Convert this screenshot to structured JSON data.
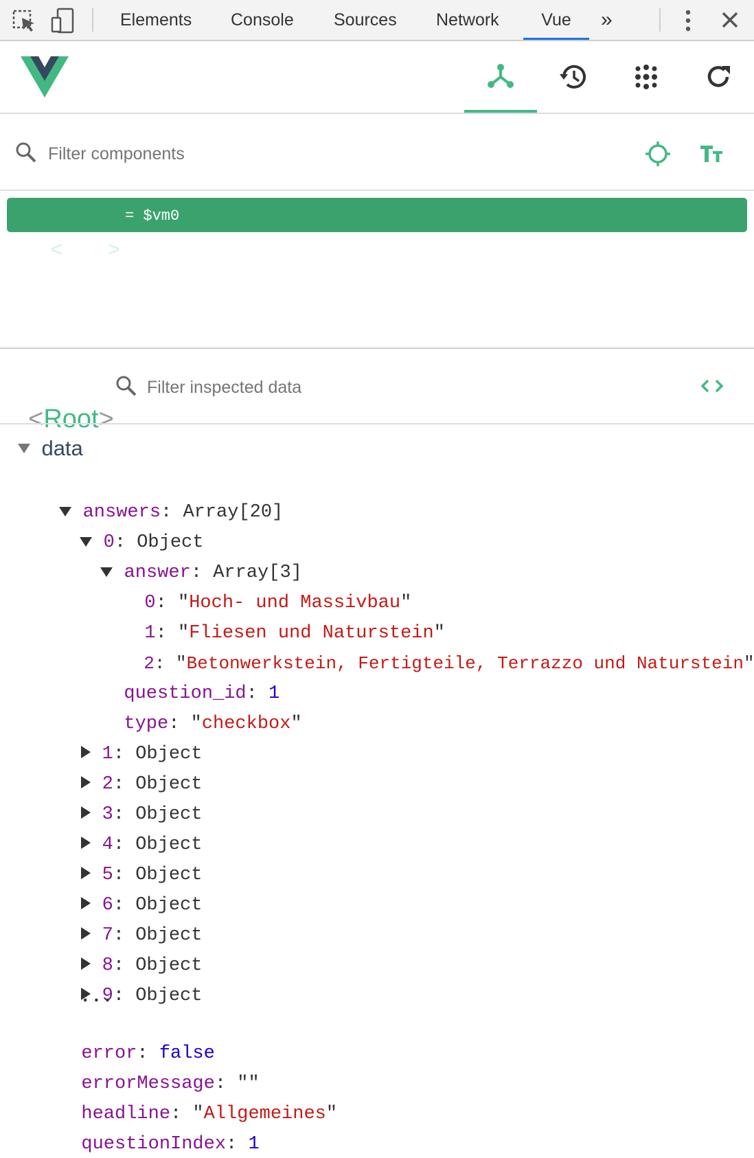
{
  "devtools": {
    "tabs": [
      "Elements",
      "Console",
      "Sources",
      "Network",
      "Vue"
    ],
    "active_tab": "Vue",
    "more_label": "»"
  },
  "components": {
    "filter_placeholder": "Filter components",
    "root_tag_open": "<",
    "root_name": "Root",
    "root_tag_close": ">",
    "root_ref": "= $vm0"
  },
  "inspector": {
    "title_name": "Root",
    "filter_placeholder": "Filter inspected data",
    "section": "data",
    "answers_key": "answers",
    "answers_type": "Array[20]",
    "item0_key": "0",
    "item0_type": "Object",
    "answer_key": "answer",
    "answer_type": "Array[3]",
    "answer_values": [
      {
        "index": "0",
        "value": "Hoch- und Massivbau"
      },
      {
        "index": "1",
        "value": "Fliesen und Naturstein"
      },
      {
        "index": "2",
        "value": "Betonwerkstein, Fertigteile, Terrazzo und Naturstein"
      }
    ],
    "question_id_key": "question_id",
    "question_id_value": "1",
    "type_key": "type",
    "type_value": "checkbox",
    "collapsed_items": [
      {
        "index": "1",
        "type": "Object"
      },
      {
        "index": "2",
        "type": "Object"
      },
      {
        "index": "3",
        "type": "Object"
      },
      {
        "index": "4",
        "type": "Object"
      },
      {
        "index": "5",
        "type": "Object"
      },
      {
        "index": "6",
        "type": "Object"
      },
      {
        "index": "7",
        "type": "Object"
      },
      {
        "index": "8",
        "type": "Object"
      },
      {
        "index": "9",
        "type": "Object"
      }
    ],
    "ellipsis": "...",
    "error_key": "error",
    "error_value": "false",
    "errorMessage_key": "errorMessage",
    "errorMessage_value": "\"\"",
    "headline_key": "headline",
    "headline_value": "Allgemeines",
    "questionIndex_key": "questionIndex",
    "questionIndex_value": "1"
  },
  "colors": {
    "vue_green": "#42b983",
    "selected_row": "#3ba26e",
    "key_purple": "#881391",
    "string_red": "#c41a16",
    "literal_blue": "#1c00cf"
  },
  "icons": [
    "inspect-element-icon",
    "device-toolbar-icon",
    "more-tabs-icon",
    "kebab-menu-icon",
    "close-icon",
    "vue-logo",
    "components-tree-icon",
    "history-icon",
    "vuex-icon",
    "refresh-icon",
    "search-icon",
    "target-icon",
    "text-size-icon",
    "code-icon"
  ]
}
